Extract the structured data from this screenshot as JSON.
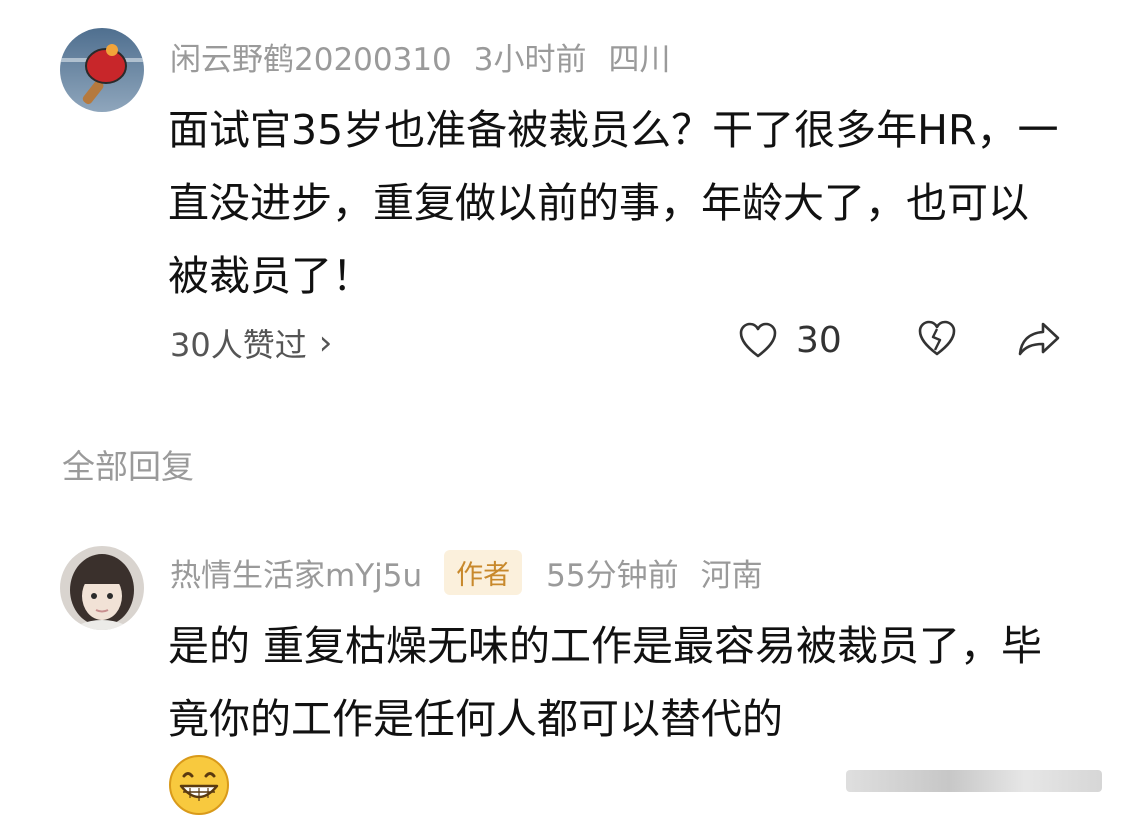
{
  "comment": {
    "username": "闲云野鹤20200310",
    "time": "3小时前",
    "location": "四川",
    "text": "面试官35岁也准备被裁员么？干了很多年HR，一直没进步，重复做以前的事，年龄大了，也可以被裁员了！",
    "liked_by": "30人赞过",
    "like_count": "30",
    "avatar_icon": "ping-pong-paddle-icon"
  },
  "replies_section": {
    "title": "全部回复"
  },
  "reply": {
    "username": "热情生活家mYj5u",
    "badge": "作者",
    "time": "55分钟前",
    "location": "河南",
    "text": "是的 重复枯燥无味的工作是最容易被裁员了，毕竟你的工作是任何人都可以替代的",
    "emoji_icon": "grinning-face-icon"
  },
  "colors": {
    "meta_text": "#9a9a9a",
    "body_text": "#111111",
    "badge_bg": "#fbf0dc",
    "badge_text": "#c8892c"
  }
}
